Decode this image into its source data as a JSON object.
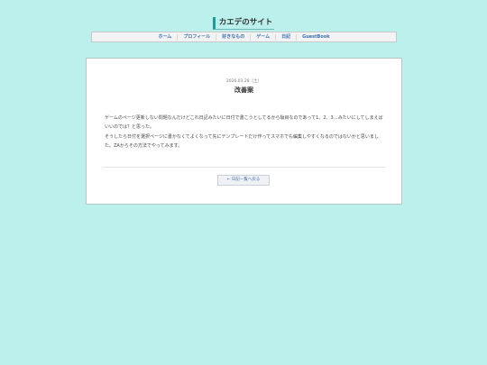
{
  "site": {
    "title": "カエデのサイト"
  },
  "nav": {
    "items": [
      {
        "label": "ホーム"
      },
      {
        "label": "プロフィール"
      },
      {
        "label": "好きなもの"
      },
      {
        "label": "ゲーム"
      },
      {
        "label": "日記"
      },
      {
        "label": "GuestBook"
      }
    ]
  },
  "post": {
    "date": "2026.03.28（土）",
    "title": "改善案",
    "paragraphs": [
      "ゲームのページ更新しない問題なんだけどこれ日記みたいに日付で書こうとしてるから駄目なのであって1、2、3…みたいにしてしまえばいいのでは？と思った。",
      "そうしたら日付を選択ページに書かなくてよくなって先にテンプレートだけ作ってスマホでも編集しやすくなるのではないかと思いました。ZAからその方法でやってみます。"
    ]
  },
  "back_button": {
    "label": "← 日記一覧へ戻る"
  },
  "colors": {
    "background": "#bcf0ec",
    "accent": "#1a9e96",
    "link": "#3a6fb0"
  }
}
